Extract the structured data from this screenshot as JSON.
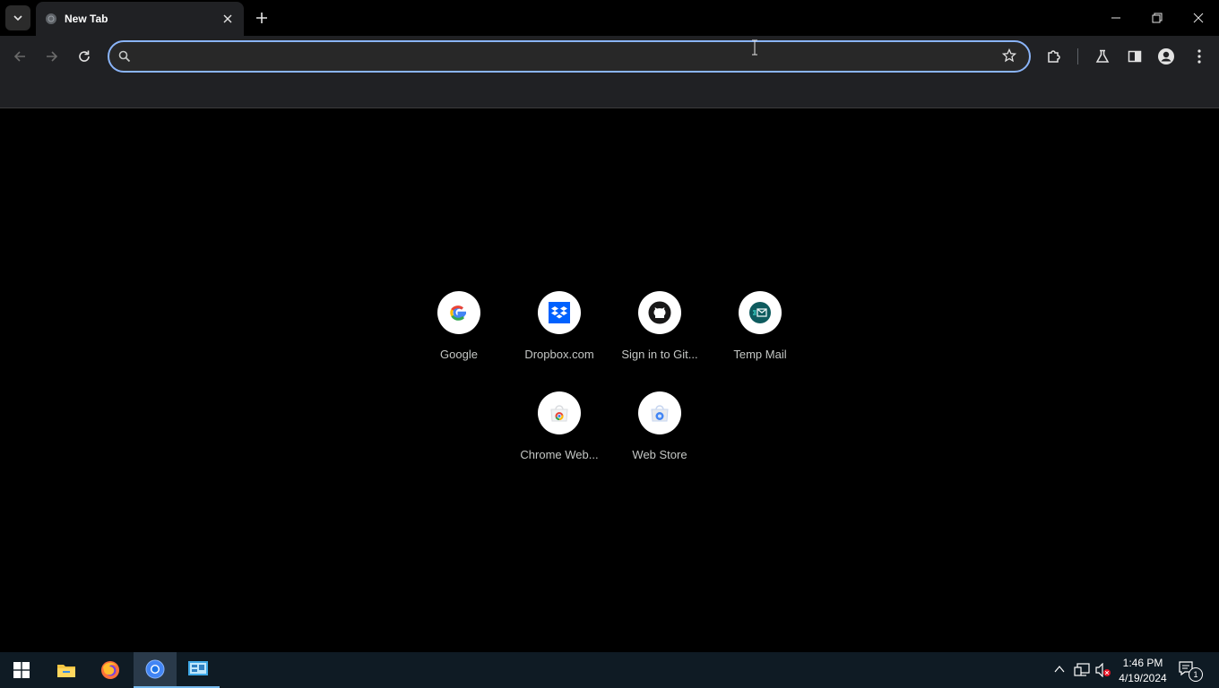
{
  "browser": {
    "tab": {
      "title": "New Tab"
    },
    "omnibox": {
      "value": "",
      "placeholder": ""
    }
  },
  "shortcuts": [
    {
      "label": "Google",
      "icon": "google-icon"
    },
    {
      "label": "Dropbox.com",
      "icon": "dropbox-icon"
    },
    {
      "label": "Sign in to Git...",
      "icon": "github-icon"
    },
    {
      "label": "Temp Mail",
      "icon": "temp-mail-icon"
    },
    {
      "label": "Chrome Web...",
      "icon": "chrome-web-store-icon"
    },
    {
      "label": "Web Store",
      "icon": "web-store-icon"
    }
  ],
  "taskbar": {
    "apps": [
      "windows-start-icon",
      "file-explorer-icon",
      "firefox-icon",
      "chrome-icon",
      "control-panel-icon"
    ],
    "clock": {
      "time": "1:46 PM",
      "date": "4/19/2024"
    },
    "notification_count": "1"
  },
  "colors": {
    "accent": "#8ab4f8",
    "toolbar": "#202124",
    "taskbar": "#0f1b24"
  }
}
